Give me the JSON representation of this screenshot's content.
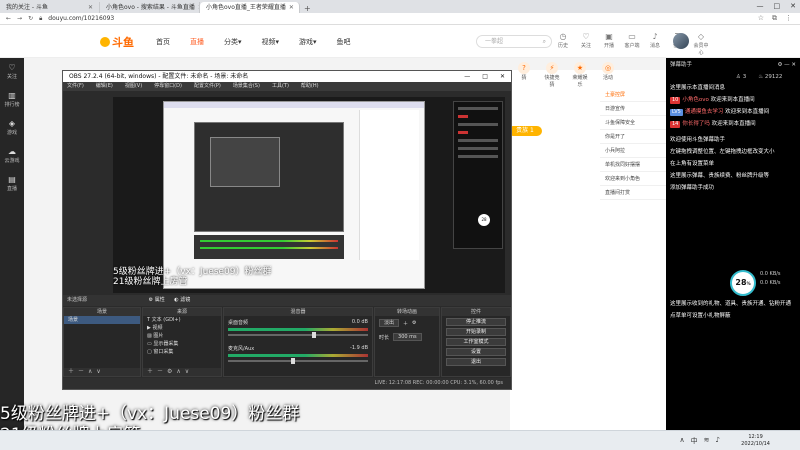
{
  "browser": {
    "tabs": [
      {
        "label": "我的关注 - 斗鱼",
        "active": false
      },
      {
        "label": "小角色ovo - 搜索结果 - 斗鱼直播",
        "active": false
      },
      {
        "label": "小角色ovo直播_王者荣耀直播",
        "active": true
      }
    ],
    "new_tab": "+",
    "window_controls": [
      "—",
      "□",
      "✕"
    ],
    "url": "douyu.com/10216093"
  },
  "douyu": {
    "logo": "斗鱼",
    "nav": [
      {
        "label": "首页",
        "active": false
      },
      {
        "label": "直播",
        "active": true
      },
      {
        "label": "分类▾",
        "active": false
      },
      {
        "label": "视频▾",
        "active": false
      },
      {
        "label": "游戏▾",
        "active": false
      },
      {
        "label": "鱼吧",
        "active": false
      }
    ],
    "search_placeholder": "一拳超",
    "header_icons": [
      {
        "label": "历史",
        "icon": "clock-icon"
      },
      {
        "label": "关注",
        "icon": "heart-icon"
      },
      {
        "label": "开播",
        "icon": "camera-icon"
      },
      {
        "label": "客户端",
        "icon": "monitor-icon"
      },
      {
        "label": "消息",
        "icon": "bell-icon"
      },
      {
        "label": "任务",
        "icon": "task-icon"
      },
      {
        "label": "会员中心",
        "icon": "vip-icon"
      }
    ],
    "badge_count": "20"
  },
  "left_sidebar": [
    {
      "label": "关注",
      "icon": "heart-icon"
    },
    {
      "label": "排行榜",
      "icon": "rank-icon"
    },
    {
      "label": "游戏",
      "icon": "game-icon"
    },
    {
      "label": "云游戏",
      "icon": "cloud-icon"
    },
    {
      "label": "直播",
      "icon": "tv-icon"
    }
  ],
  "tool_icons": [
    {
      "label": "猜",
      "icon": "guess-icon"
    },
    {
      "label": "快捷竞猜",
      "icon": "quick-icon"
    },
    {
      "label": "荣耀娱乐",
      "icon": "glory-icon"
    },
    {
      "label": "活动",
      "icon": "event-icon"
    }
  ],
  "orange_badge": "贵族 1",
  "right_panel": {
    "notice": "土豪控屏",
    "items": [
      "日游宣传",
      "斗鱼保障安全",
      "你是开了",
      "小兵阿拉",
      "单机找同好摆摆",
      "欢迎来到小角色",
      "直播间打赏"
    ]
  },
  "obs": {
    "title": "OBS 27.2.4 (64-bit, windows) - 配置文件: 未命名 - 场景: 未命名",
    "window_controls": [
      "—",
      "□",
      "✕"
    ],
    "menu": [
      "文件(F)",
      "编辑(E)",
      "视图(V)",
      "停靠窗口(D)",
      "配置文件(P)",
      "场景集合(S)",
      "工具(T)",
      "帮助(H)"
    ],
    "preview_text": [
      "5级粉丝牌进+（vx：Juese09）粉丝群",
      "21级粉丝牌上房管"
    ],
    "source_bar": {
      "label": "未选择源",
      "properties": "属性",
      "filters": "滤镜"
    },
    "docks": {
      "scenes": {
        "title": "场景",
        "items": [
          "场景"
        ]
      },
      "sources": {
        "title": "来源",
        "items": [
          "文本 (GDI+)",
          "视频",
          "图片",
          "显示器采集",
          "窗口采集"
        ]
      },
      "mixer": {
        "title": "混音器",
        "channels": [
          {
            "name": "桌面音频",
            "db": "0.0 dB",
            "level": 0.6
          },
          {
            "name": "麦克风/Aux",
            "db": "-1.9 dB",
            "level": 0.45
          }
        ]
      },
      "transitions": {
        "title": "转场动画",
        "type": "淡出",
        "duration_label": "时长",
        "duration": "300 ms"
      },
      "controls": {
        "title": "控件",
        "buttons": [
          "停止推流",
          "开始录制",
          "工作室模式",
          "设置",
          "退出"
        ]
      }
    },
    "status": "LIVE: 12:17:08   REC: 00:00:00   CPU: 3.1%, 60.00 fps"
  },
  "overlay_text": [
    "5级粉丝牌进+（vx：Juese09）粉丝群",
    "21级粉丝牌上房管"
  ],
  "live_panel": {
    "title": "弹幕助手",
    "stats": [
      "3",
      "29122"
    ],
    "lines": [
      {
        "text": "这里展示本直播间消息",
        "tag": "",
        "tag_color": ""
      },
      {
        "tag": "10",
        "tag_color": "red",
        "name": "小角色ovo",
        "text": "欢迎来到本直播间"
      },
      {
        "tag": "LV5",
        "tag_color": "blue",
        "name": "通通摸鱼去学习",
        "text": "欢迎来到本直播间"
      },
      {
        "tag": "14",
        "tag_color": "red",
        "name": "你长得了吗",
        "text": "欢迎来到本直播间"
      },
      {
        "text": "欢迎使用斗鱼弹幕助手",
        "tag": "",
        "tag_color": ""
      },
      {
        "text": "左键拖拽调整位置、左键拖拽边框改变大小",
        "tag": "",
        "tag_color": ""
      },
      {
        "text": "在上角有设置菜单",
        "tag": "",
        "tag_color": ""
      },
      {
        "text": "这里展示弹幕、贵族续费、粉丝牌升级等",
        "tag": "",
        "tag_color": ""
      },
      {
        "text": "添加弹幕助手成功",
        "tag": "",
        "tag_color": ""
      }
    ],
    "progress_pct": 28,
    "progress_label": "28",
    "progress_info": [
      "0.0 KB/s",
      "0.0 KB/s"
    ],
    "bottom_lines": [
      "这里展示收到的礼物、道具、贵族开通、钻粉开通",
      "点草单可设置小礼物屏蔽"
    ]
  },
  "taskbar": {
    "time": "12:19",
    "date": "2022/10/14",
    "lang": "中"
  }
}
